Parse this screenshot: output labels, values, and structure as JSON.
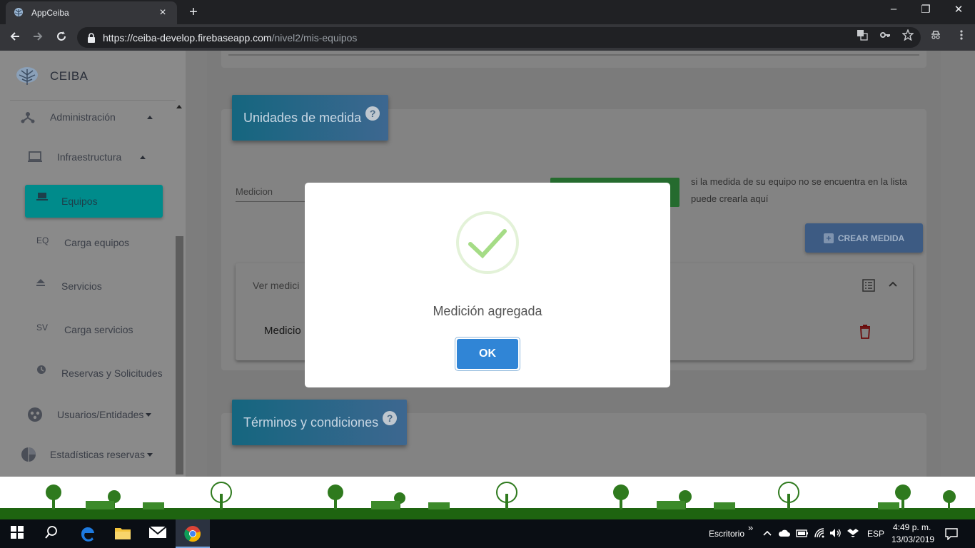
{
  "browser": {
    "tab_title": "AppCeiba",
    "tab_close": "×",
    "new_tab": "+",
    "url_host": "https://ceiba-develop.firebaseapp.com",
    "url_path": "/nivel2/mis-equipos",
    "window_controls": {
      "minimize": "–",
      "restore": "❐",
      "close": "✕"
    }
  },
  "sidebar": {
    "brand": "CEIBA",
    "items": [
      {
        "label": "Administración",
        "icon": "hierarchy-icon"
      },
      {
        "label": "Infraestructura",
        "icon": "laptop-icon"
      },
      {
        "label": "Equipos",
        "icon": "laptop-icon",
        "active": true
      },
      {
        "label": "Carga equipos",
        "prefix": "EQ"
      },
      {
        "label": "Servicios",
        "icon": "eject-icon"
      },
      {
        "label": "Carga servicios",
        "prefix": "SV"
      },
      {
        "label": "Reservas y Solicitudes",
        "icon": "clock-icon"
      },
      {
        "label": "Usuarios/Entidades",
        "icon": "users-icon"
      },
      {
        "label": "Estadísticas reservas",
        "icon": "pie-chart-icon"
      }
    ]
  },
  "main": {
    "units_section": {
      "title": "Unidades de medida",
      "help": "?",
      "field_label": "Medicion",
      "hint_line1": "si la medida de su equipo no se encuentra en la lista",
      "hint_line2": "puede crearla aquí",
      "create_button": "CREAR MEDIDA",
      "panel_title": "Ver medici",
      "row_label": "Medicio"
    },
    "terms_section": {
      "title": "Términos y condiciones",
      "help": "?"
    }
  },
  "dialog": {
    "message": "Medición agregada",
    "ok_label": "OK"
  },
  "taskbar": {
    "desktop_label": "Escritorio",
    "chevron": "»",
    "language": "ESP",
    "time": "4:49 p. m.",
    "date": "13/03/2019"
  },
  "colors": {
    "sidebar_active": "#008b8b",
    "header_gradient_start": "#15667f",
    "ok_button": "#3085d6",
    "success_check": "#a5dc86"
  }
}
